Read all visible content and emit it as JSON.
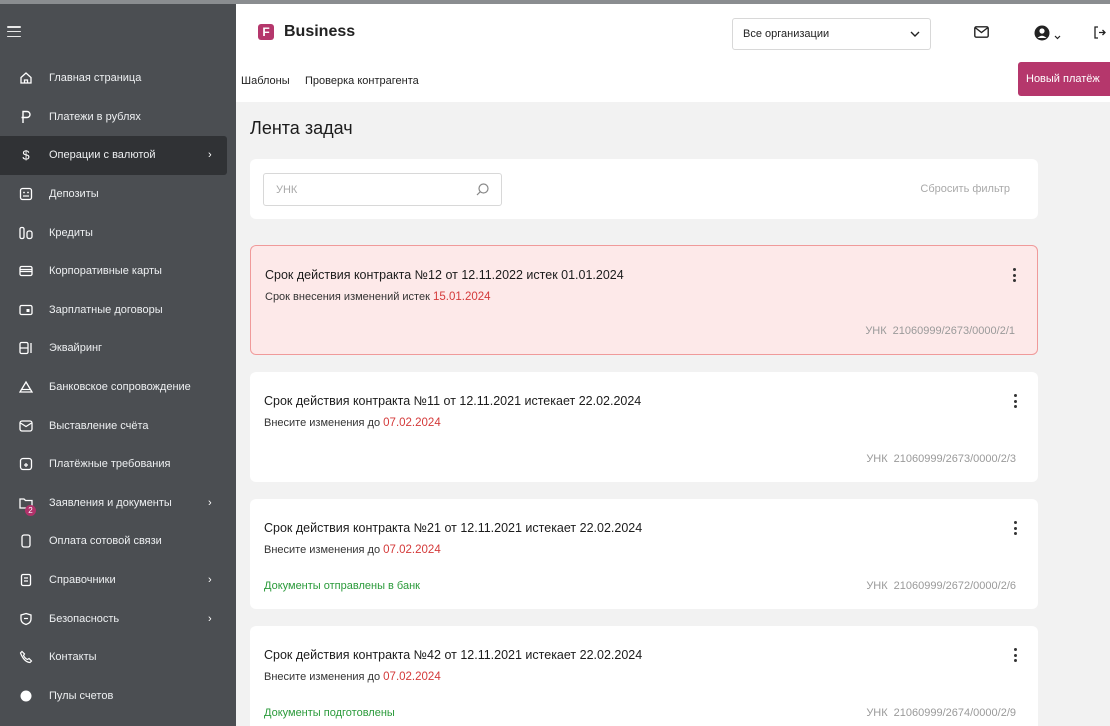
{
  "sidebar": {
    "items": [
      {
        "label": "Главная страница",
        "icon": "home-icon",
        "chevron": ""
      },
      {
        "label": "Платежи в рублях",
        "icon": "ruble-icon",
        "chevron": ""
      },
      {
        "label": "Операции с валютой",
        "icon": "dollar-icon",
        "chevron": "›"
      },
      {
        "label": "Депозиты",
        "icon": "deposit-icon",
        "chevron": ""
      },
      {
        "label": "Кредиты",
        "icon": "credit-icon",
        "chevron": ""
      },
      {
        "label": "Корпоративные карты",
        "icon": "card-icon",
        "chevron": ""
      },
      {
        "label": "Зарплатные договоры",
        "icon": "salary-icon",
        "chevron": ""
      },
      {
        "label": "Эквайринг",
        "icon": "acquiring-icon",
        "chevron": ""
      },
      {
        "label": "Банковское сопровождение",
        "icon": "bank-support-icon",
        "chevron": ""
      },
      {
        "label": "Выставление счёта",
        "icon": "invoice-icon",
        "chevron": ""
      },
      {
        "label": "Платёжные требования",
        "icon": "payment-request-icon",
        "chevron": ""
      },
      {
        "label": "Заявления и документы",
        "icon": "folder-icon",
        "chevron": "›",
        "badge": "2"
      },
      {
        "label": "Оплата сотовой связи",
        "icon": "phone-icon",
        "chevron": ""
      },
      {
        "label": "Справочники",
        "icon": "directory-icon",
        "chevron": "›"
      },
      {
        "label": "Безопасность",
        "icon": "shield-icon",
        "chevron": "›"
      },
      {
        "label": "Контакты",
        "icon": "contact-phone-icon",
        "chevron": ""
      },
      {
        "label": "Пулы счетов",
        "icon": "circle-icon",
        "chevron": ""
      }
    ]
  },
  "header": {
    "logo_letter": "F",
    "logo_text": "Business",
    "org_select": "Все организации"
  },
  "subnav": {
    "templates": "Шаблоны",
    "check_counterparty": "Проверка контрагента",
    "new_payment": "Новый платёж"
  },
  "main": {
    "title": "Лента задач",
    "search_placeholder": "УНК",
    "reset_filter": "Сбросить фильтр"
  },
  "tasks": [
    {
      "title": "Срок действия контракта №12 от 12.11.2022 истек 01.01.2024",
      "sub_text": "Срок внесения изменений истек",
      "date": "15.01.2024",
      "status": "",
      "unk_label": "УНК",
      "unk": "21060999/2673/0000/2/1"
    },
    {
      "title": "Срок действия контракта №11 от 12.11.2021 истекает 22.02.2024",
      "sub_text": "Внесите изменения до",
      "date": "07.02.2024",
      "status": "",
      "unk_label": "УНК",
      "unk": "21060999/2673/0000/2/3"
    },
    {
      "title": "Срок действия контракта №21 от 12.11.2021 истекает 22.02.2024",
      "sub_text": "Внесите изменения до",
      "date": "07.02.2024",
      "status": "Документы отправлены в банк",
      "unk_label": "УНК",
      "unk": "21060999/2672/0000/2/6"
    },
    {
      "title": "Срок действия контракта №42 от 12.11.2021 истекает 22.02.2024",
      "sub_text": "Внесите изменения до",
      "date": "07.02.2024",
      "status": "Документы подготовлены",
      "unk_label": "УНК",
      "unk": "21060999/2674/0000/2/9"
    }
  ],
  "colors": {
    "brand": "#b5376c",
    "sidebar_bg": "#4b4e52",
    "alert_bg": "#fde9e9",
    "alert_border": "#f09a9a",
    "date_red": "#d43a3a",
    "status_green": "#2a9a3a"
  }
}
